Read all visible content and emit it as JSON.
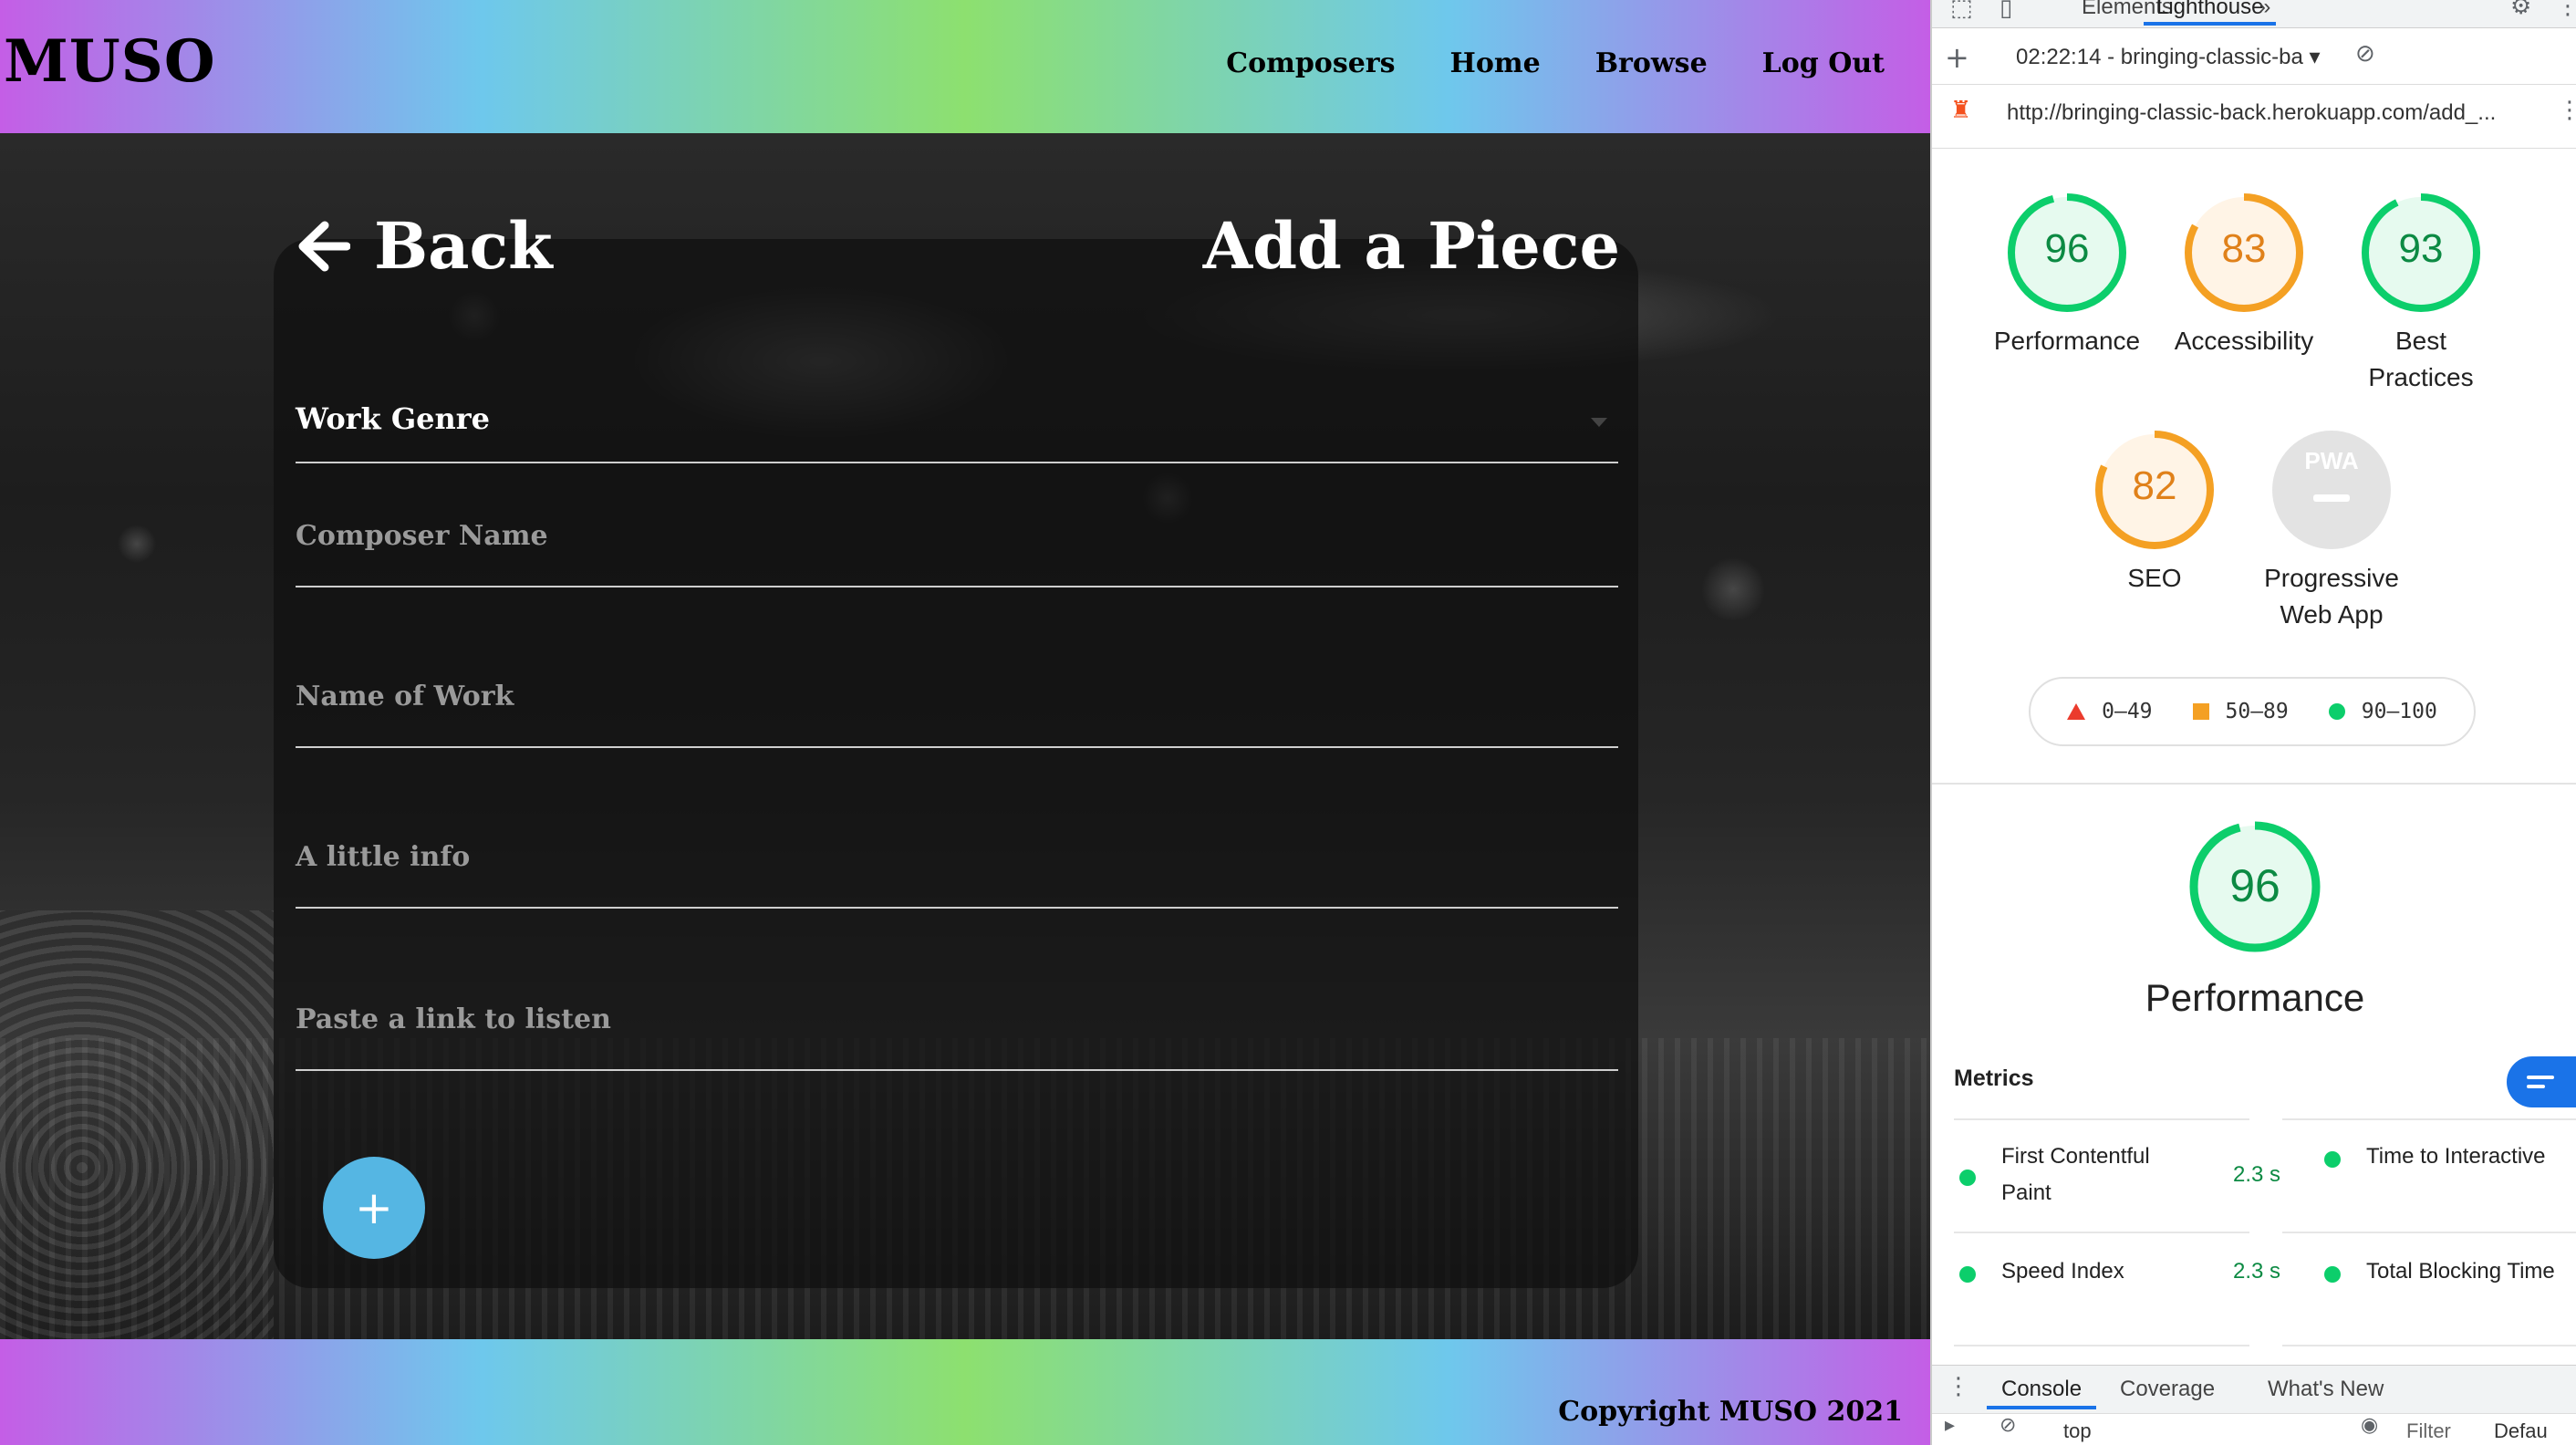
{
  "app": {
    "logo": "MUSO",
    "nav": [
      "Composers",
      "Home",
      "Browse",
      "Log Out"
    ],
    "back_label": "Back",
    "page_title": "Add a Piece",
    "form": {
      "genre_label": "Work Genre",
      "composer_placeholder": "Composer Name",
      "work_placeholder": "Name of Work",
      "info_placeholder": "A little info",
      "link_placeholder": "Paste a link to listen",
      "add_button": "+"
    },
    "footer": "Copyright MUSO 2021"
  },
  "devtools": {
    "tabs": [
      "Elements",
      "Lighthouse"
    ],
    "more_tabs": "»",
    "report_select": "02:22:14 - bringing-classic-ba ▾",
    "url": "http://bringing-classic-back.herokuapp.com/add_...",
    "categories": [
      {
        "label": "Performance",
        "score": 96,
        "color": "#0cce6b"
      },
      {
        "label": "Accessibility",
        "score": 83,
        "color": "#f4a023"
      },
      {
        "label": "Best\nPractices",
        "label1": "Best",
        "label2": "Practices",
        "score": 93,
        "color": "#0cce6b"
      },
      {
        "label": "SEO",
        "score": 82,
        "color": "#f4a023"
      },
      {
        "label1": "Progressive",
        "label2": "Web App",
        "score": null,
        "badge": "PWA"
      }
    ],
    "legend": [
      "0–49",
      "50–89",
      "90–100"
    ],
    "summary": {
      "score": 96,
      "title": "Performance"
    },
    "metrics_title": "Metrics",
    "metrics": [
      {
        "name1": "First Contentful",
        "name2": "Paint",
        "value": "2.3 s"
      },
      {
        "name1": "Time to Interactive",
        "name2": "",
        "value": ""
      },
      {
        "name1": "Speed Index",
        "name2": "",
        "value": "2.3 s"
      },
      {
        "name1": "Total Blocking Time",
        "name2": "",
        "value": ""
      }
    ],
    "drawer_tabs": [
      "Console",
      "Coverage",
      "What's New"
    ],
    "drawer_bottom": {
      "context": "top",
      "filter": "Filter",
      "levels": "Defau"
    }
  }
}
